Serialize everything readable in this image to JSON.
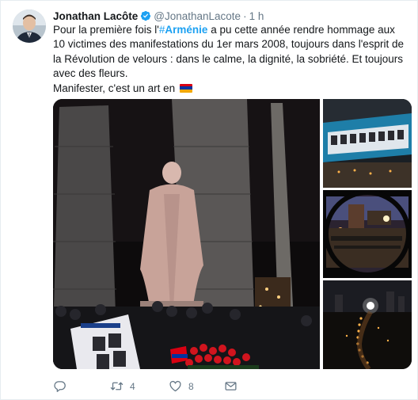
{
  "tweet": {
    "author": {
      "display_name": "Jonathan Lacôte",
      "handle": "@JonathanLacote",
      "separator": "·",
      "time": "1 h",
      "avatar_icon": "avatar-photo",
      "verified_icon": "verified-badge-icon"
    },
    "text": {
      "part1": "Pour la première fois l'",
      "hashtag_symbol": "#",
      "hashtag_word": "Arménie",
      "part2": " a pu cette année rendre hommage aux 10 victimes des manifestations du 1er mars 2008, toujours dans l'esprit de la Révolution de velours : dans le calme, la dignité, la sobriété. Et toujours avec des fleurs.",
      "line2": "Manifester, c'est un art en",
      "flag_icon": "armenia-flag-emoji"
    },
    "media": {
      "photos": [
        {
          "name": "main-photo",
          "description_icon": "statue-at-night-photo"
        },
        {
          "name": "banner-photo",
          "description_icon": "banner-with-portraits-photo"
        },
        {
          "name": "circular-view-photo",
          "description_icon": "square-at-night-photo"
        },
        {
          "name": "candles-photo",
          "description_icon": "candles-on-ground-photo"
        }
      ]
    },
    "actions": {
      "reply": {
        "icon": "reply-icon",
        "count": ""
      },
      "retweet": {
        "icon": "retweet-icon",
        "count": "4"
      },
      "like": {
        "icon": "heart-icon",
        "count": "8"
      },
      "message": {
        "icon": "envelope-icon",
        "count": ""
      }
    },
    "colors": {
      "link": "#1da1f2",
      "secondary_text": "#657786",
      "primary_text": "#14171a",
      "flag_red": "#d90012",
      "flag_blue": "#0033a0",
      "flag_orange": "#f2a800"
    }
  }
}
